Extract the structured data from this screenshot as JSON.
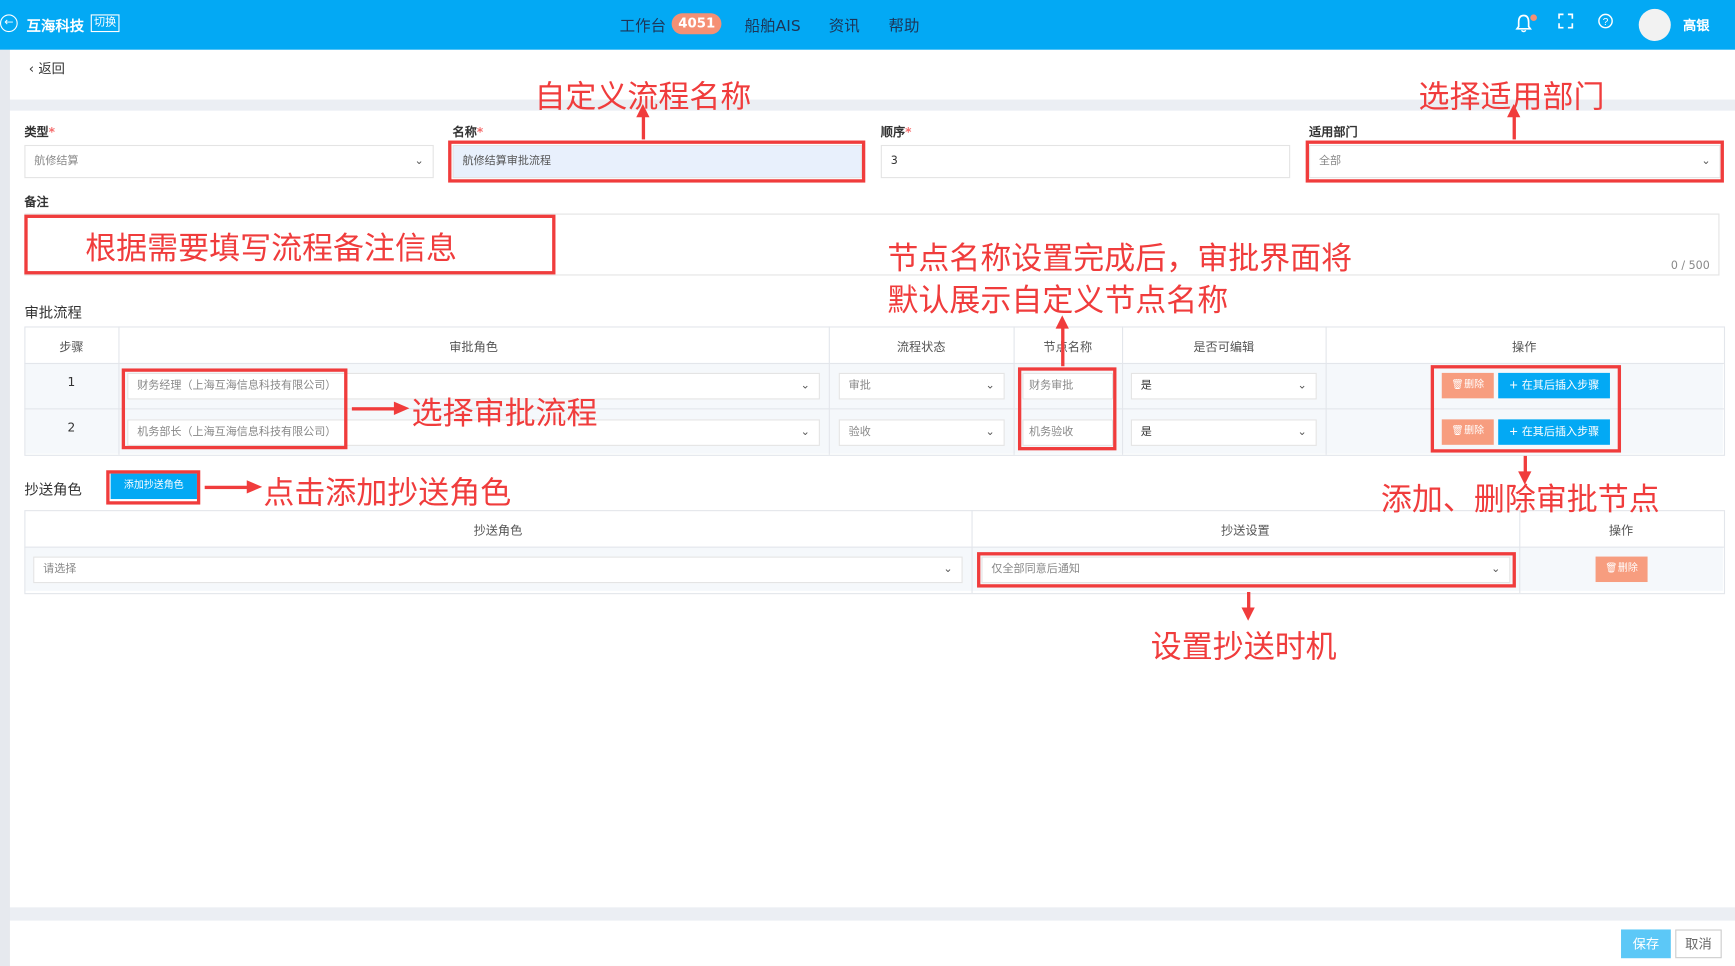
{
  "header": {
    "brand": "互海科技",
    "switch_label": "切换",
    "nav": [
      {
        "label": "工作台",
        "badge": "4051"
      },
      {
        "label": "船舶AIS"
      },
      {
        "label": "资讯"
      },
      {
        "label": "帮助"
      }
    ],
    "user_name": "高银",
    "colors": {
      "bar": "#03a9f4",
      "badge": "#f59074"
    }
  },
  "back_label": "返回",
  "form": {
    "type": {
      "label": "类型",
      "required": "*",
      "value": "航修结算"
    },
    "name": {
      "label": "名称",
      "required": "*",
      "value": "航修结算审批流程"
    },
    "order": {
      "label": "顺序",
      "required": "*",
      "value": "3"
    },
    "dept": {
      "label": "适用部门",
      "value": "全部"
    },
    "remark": {
      "label": "备注",
      "counter": "0 / 500"
    }
  },
  "approval": {
    "title": "审批流程",
    "columns": [
      "步骤",
      "审批角色",
      "流程状态",
      "节点名称",
      "是否可编辑",
      "操作"
    ],
    "rows": [
      {
        "step": "1",
        "role": "财务经理（上海互海信息科技有限公司）",
        "status": "审批",
        "node": "财务审批",
        "editable": "是"
      },
      {
        "step": "2",
        "role": "机务部长（上海互海信息科技有限公司）",
        "status": "验收",
        "node": "机务验收",
        "editable": "是"
      }
    ],
    "delete_label": "删除",
    "insert_label": "+ 在其后插入步骤"
  },
  "cc": {
    "title": "抄送角色",
    "add_label": "添加抄送角色",
    "columns": [
      "抄送角色",
      "抄送设置",
      "操作"
    ],
    "rows": [
      {
        "role_placeholder": "请选择",
        "setting": "仅全部同意后通知"
      }
    ],
    "delete_label": "删除"
  },
  "footer": {
    "save_label": "保存",
    "cancel_label": "取消"
  },
  "annotations": {
    "name": "自定义流程名称",
    "dept": "选择适用部门",
    "remark": "根据需要填写流程备注信息",
    "node_line1": "节点名称设置完成后，审批界面将",
    "node_line2": "默认展示自定义节点名称",
    "role": "选择审批流程",
    "add_cc": "点击添加抄送角色",
    "add_del": "添加、删除审批节点",
    "cc_setting": "设置抄送时机",
    "color": "#f03c3c"
  }
}
